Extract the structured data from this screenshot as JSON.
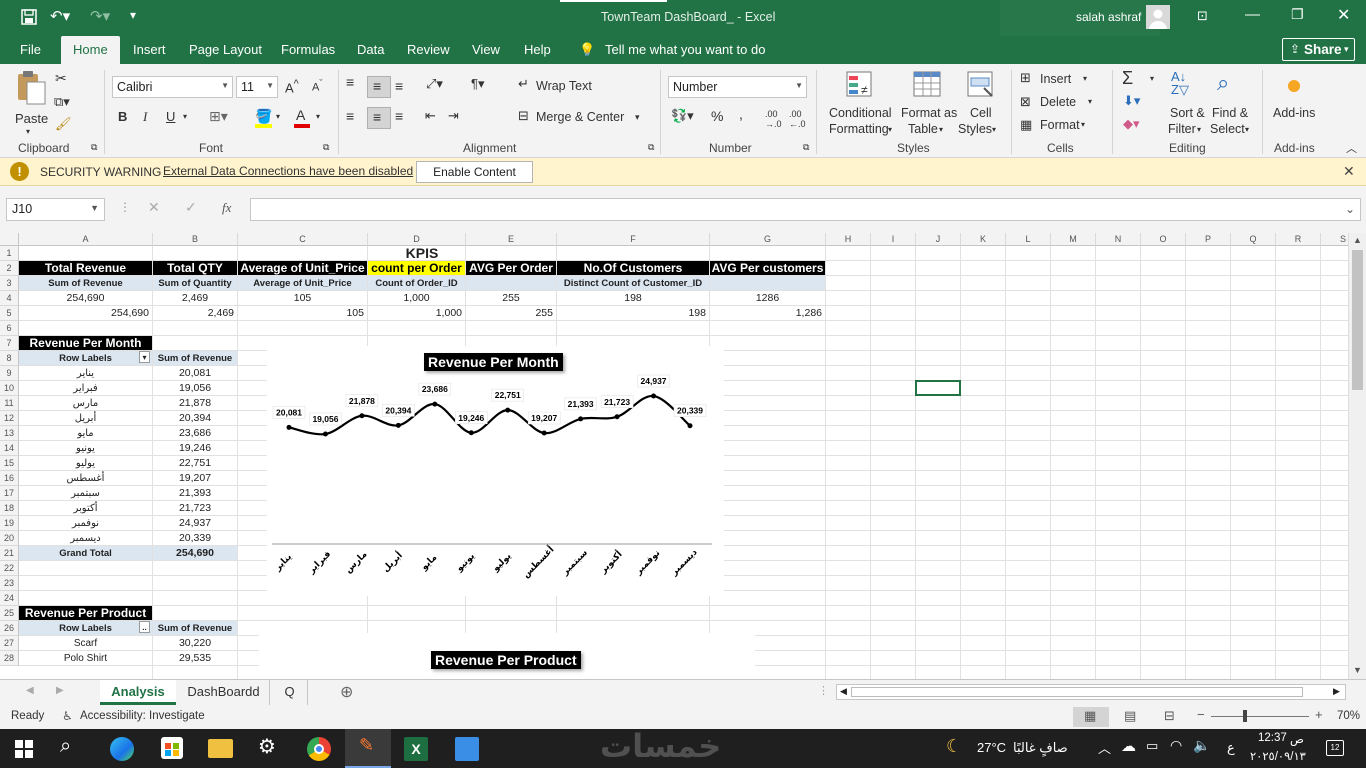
{
  "window": {
    "title": "TownTeam DashBoard_  -  Excel",
    "user": "salah ashraf"
  },
  "menu": [
    "File",
    "Home",
    "Insert",
    "Page Layout",
    "Formulas",
    "Data",
    "Review",
    "View",
    "Help"
  ],
  "tell_me": "Tell me what you want to do",
  "share": "Share",
  "ribbon": {
    "paste": "Paste",
    "clipboard": "Clipboard",
    "font_name": "Calibri",
    "font_size": "11",
    "font": "Font",
    "wrap_text": "Wrap Text",
    "merge_center": "Merge & Center",
    "alignment": "Alignment",
    "number_format": "Number",
    "number": "Number",
    "conditional_1": "Conditional",
    "conditional_2": "Formatting",
    "format_table_1": "Format as",
    "format_table_2": "Table",
    "cell_styles_1": "Cell",
    "cell_styles_2": "Styles",
    "styles": "Styles",
    "insert": "Insert",
    "delete": "Delete",
    "format": "Format",
    "cells": "Cells",
    "sort_1": "Sort &",
    "sort_2": "Filter",
    "find_1": "Find &",
    "find_2": "Select",
    "editing": "Editing",
    "addins": "Add-ins",
    "addins_group": "Add-ins"
  },
  "security": {
    "title": "SECURITY WARNING",
    "message": "External Data Connections have been disabled",
    "button": "Enable Content"
  },
  "formula": {
    "name_box": "J10",
    "fx": "fx",
    "value": ""
  },
  "columns": [
    "A",
    "B",
    "C",
    "D",
    "E",
    "F",
    "G",
    "H",
    "I",
    "J",
    "K",
    "L",
    "M",
    "N",
    "O",
    "P",
    "Q",
    "R",
    "S"
  ],
  "rows": [
    "1",
    "2",
    "3",
    "4",
    "5",
    "6",
    "7",
    "8",
    "9",
    "10",
    "11",
    "12",
    "13",
    "14",
    "15",
    "16",
    "17",
    "18",
    "19",
    "20",
    "21",
    "22",
    "23",
    "24",
    "25",
    "26",
    "27",
    "28"
  ],
  "kpis": {
    "title": "KPIS",
    "headers": [
      "Total Revenue",
      "Total QTY",
      "Average of Unit_Price",
      "count per Order",
      "AVG Per Order",
      "No.Of Customers",
      "AVG Per customers"
    ],
    "subheaders": [
      "Sum of Revenue",
      "Sum of Quantity",
      "Average of Unit_Price",
      "Count of Order_ID",
      "",
      "Distinct Count of Customer_ID",
      ""
    ],
    "row4": [
      "254,690",
      "2,469",
      "105",
      "1,000",
      "255",
      "198",
      "1286"
    ],
    "row5": [
      "254,690",
      "2,469",
      "105",
      "1,000",
      "255",
      "198",
      "1,286"
    ]
  },
  "rev_month": {
    "title": "Revenue Per Month",
    "col1": "Row Labels",
    "col2": "Sum of Revenue",
    "rows": [
      {
        "label": "يناير",
        "value": "20,081"
      },
      {
        "label": "فبراير",
        "value": "19,056"
      },
      {
        "label": "مارس",
        "value": "21,878"
      },
      {
        "label": "أبريل",
        "value": "20,394"
      },
      {
        "label": "مايو",
        "value": "23,686"
      },
      {
        "label": "يونيو",
        "value": "19,246"
      },
      {
        "label": "يوليو",
        "value": "22,751"
      },
      {
        "label": "أغسطس",
        "value": "19,207"
      },
      {
        "label": "سبتمبر",
        "value": "21,393"
      },
      {
        "label": "أكتوبر",
        "value": "21,723"
      },
      {
        "label": "نوفمبر",
        "value": "24,937"
      },
      {
        "label": "ديسمبر",
        "value": "20,339"
      }
    ],
    "total_label": "Grand Total",
    "total_value": "254,690"
  },
  "rev_product": {
    "title": "Revenue Per Product",
    "col1": "Row Labels",
    "col2": "Sum of Revenue",
    "rows": [
      {
        "label": "Scarf",
        "value": "30,220"
      },
      {
        "label": "Polo Shirt",
        "value": "29,535"
      }
    ]
  },
  "chart_data": [
    {
      "type": "line",
      "title": "Revenue Per Month",
      "categories": [
        "يناير",
        "فبراير",
        "مارس",
        "أبريل",
        "مايو",
        "يونيو",
        "يوليو",
        "أغسطس",
        "سبتمبر",
        "أكتوبر",
        "نوفمبر",
        "ديسمبر"
      ],
      "values": [
        20081,
        19056,
        21878,
        20394,
        23686,
        19246,
        22751,
        19207,
        21393,
        21723,
        24937,
        20339
      ],
      "data_labels": [
        "20,081",
        "19,056",
        "21,878",
        "20,394",
        "23,686",
        "19,246",
        "22,751",
        "19,207",
        "21,393",
        "21,723",
        "24,937",
        "20,339"
      ],
      "grid": false,
      "smooth": true
    },
    {
      "type": "bar",
      "title": "Revenue Per Product",
      "categories": [],
      "values": []
    }
  ],
  "sheet_tabs": [
    "Analysis",
    "DashBoardd",
    "Q"
  ],
  "active_tab": "Analysis",
  "status": {
    "ready": "Ready",
    "accessibility": "Accessibility: Investigate",
    "zoom": "70%"
  },
  "taskbar": {
    "weather": "27°C",
    "weather_desc": "صافٍ غالبًا",
    "time": "12:37",
    "ampm": "ص",
    "date": "٢٠٢٥/٠٩/١٣",
    "lang": "ع",
    "notif": "12"
  },
  "colors": {
    "excel_green": "#217346",
    "warning_bg": "#fff4ce",
    "yellow_header": "#ffff00"
  }
}
